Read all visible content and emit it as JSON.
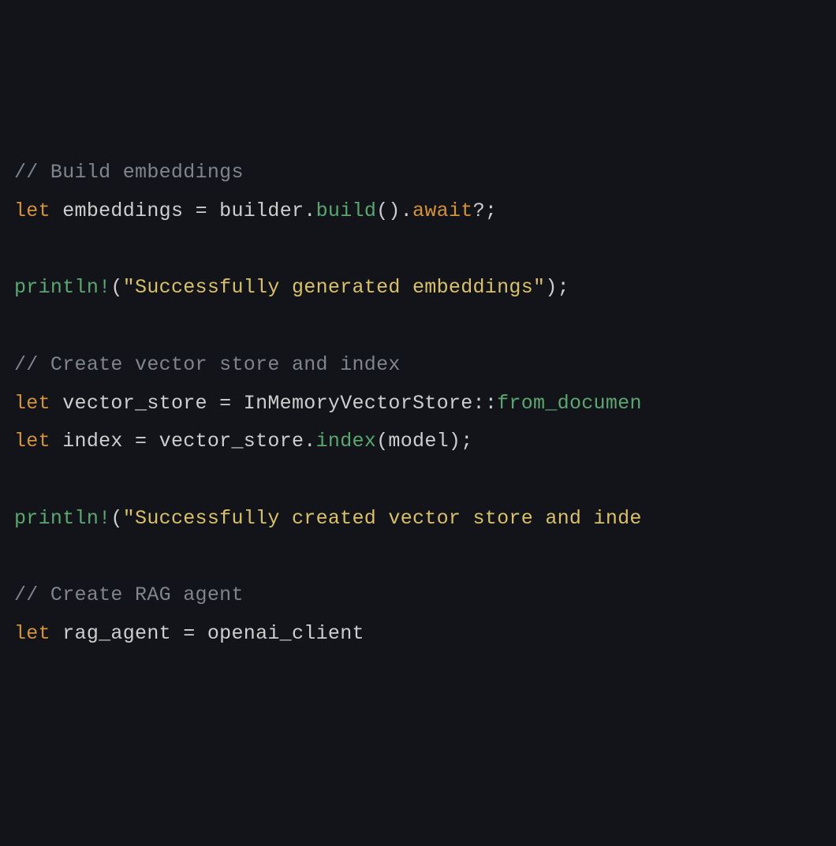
{
  "code": {
    "l1_comment": "// Build embeddings",
    "l2_let": "let",
    "l2_var": " embeddings ",
    "l2_eq": "=",
    "l2_builder": " builder.",
    "l2_build": "build",
    "l2_p1": "().",
    "l2_await": "await",
    "l2_qm": "?;",
    "l3_println": "println!",
    "l3_open": "(",
    "l3_str": "\"Successfully generated embeddings\"",
    "l3_close": ");",
    "l4_comment": "// Create vector store and index",
    "l5_let": "let",
    "l5_var": " vector_store ",
    "l5_eq": "=",
    "l5_ty": " InMemoryVectorStore::",
    "l5_fn": "from_documen",
    "l6_let": "let",
    "l6_var": " index ",
    "l6_eq": "=",
    "l6_obj": " vector_store.",
    "l6_fn": "index",
    "l6_args": "(model);",
    "l7_println": "println!",
    "l7_open": "(",
    "l7_str": "\"Successfully created vector store and inde",
    "l8_comment": "// Create RAG agent",
    "l9_let": "let",
    "l9_var": " rag_agent ",
    "l9_eq": "=",
    "l9_rhs": " openai_client"
  }
}
